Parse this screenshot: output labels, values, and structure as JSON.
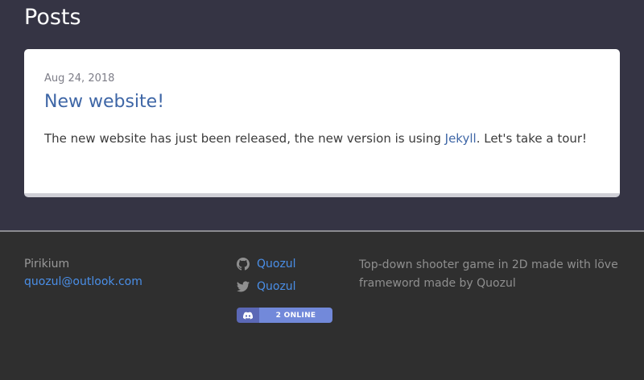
{
  "page": {
    "title": "Posts"
  },
  "posts": [
    {
      "date": "Aug 24, 2018",
      "title": "New website!",
      "excerpt_before": "The new website has just been released, the new version is using ",
      "excerpt_link": "Jekyll",
      "excerpt_after": ". Let's take a tour!"
    }
  ],
  "footer": {
    "site_name": "Pirikium",
    "email": "quozul@outlook.com",
    "github": {
      "icon": "github-icon",
      "label": "Quozul"
    },
    "twitter": {
      "icon": "twitter-icon",
      "label": "Quozul"
    },
    "discord_badge": {
      "icon": "discord-icon",
      "label": "2 ONLINE"
    },
    "description": "Top-down shooter game in 2D made with löve frameword made by Quozul"
  },
  "colors": {
    "background": "#353444",
    "footer_background": "#2f2f2f",
    "link": "#4a8fe8",
    "post_title": "#3e66a6",
    "discord": "#7289da"
  }
}
